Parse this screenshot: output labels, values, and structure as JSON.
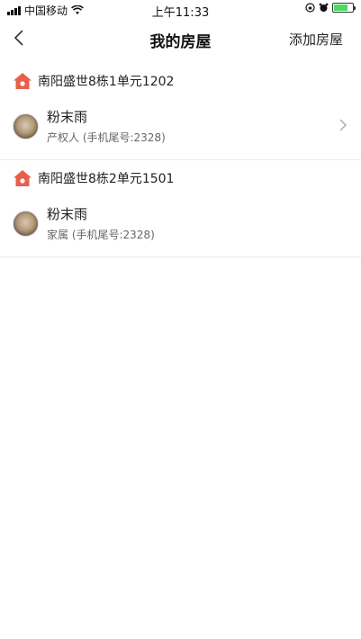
{
  "status_bar": {
    "carrier": "中国移动",
    "time": "上午11:33"
  },
  "nav": {
    "title": "我的房屋",
    "action_label": "添加房屋"
  },
  "houses": [
    {
      "address": "南阳盛世8栋1单元1202",
      "person_name": "粉末雨",
      "person_role": "产权人 (手机尾号:2328)"
    },
    {
      "address": "南阳盛世8栋2单元1501",
      "person_name": "粉末雨",
      "person_role": "家属 (手机尾号:2328)"
    }
  ],
  "colors": {
    "house_icon": "#e8604c",
    "battery": "#4cd964"
  },
  "icons": [
    "signal-icon",
    "wifi-icon",
    "alarm-icon",
    "battery-icon",
    "back-arrow-icon",
    "house-icon",
    "chevron-right-icon"
  ]
}
